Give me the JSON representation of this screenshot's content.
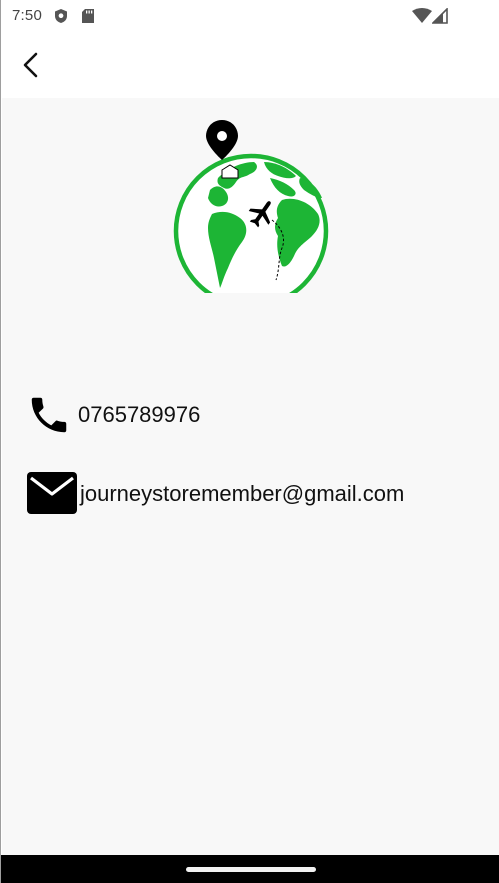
{
  "status_bar": {
    "time": "7:50",
    "icons": [
      "shield-icon",
      "sd-card-icon",
      "wifi-icon",
      "signal-icon"
    ]
  },
  "app_bar": {
    "back_icon": "arrow-back-icon"
  },
  "logo": {
    "icon": "globe-travel-logo",
    "colors": {
      "globe": "#1db535",
      "pin": "#000000",
      "plane": "#000000"
    }
  },
  "contact": {
    "phone": {
      "icon": "phone-icon",
      "value": "0765789976"
    },
    "email": {
      "icon": "mail-icon",
      "value": "journeystoremember@gmail.com"
    }
  },
  "colors": {
    "background": "#f8f8f8",
    "app_bar": "#ffffff",
    "text": "#111111",
    "nav_bar": "#000000"
  }
}
